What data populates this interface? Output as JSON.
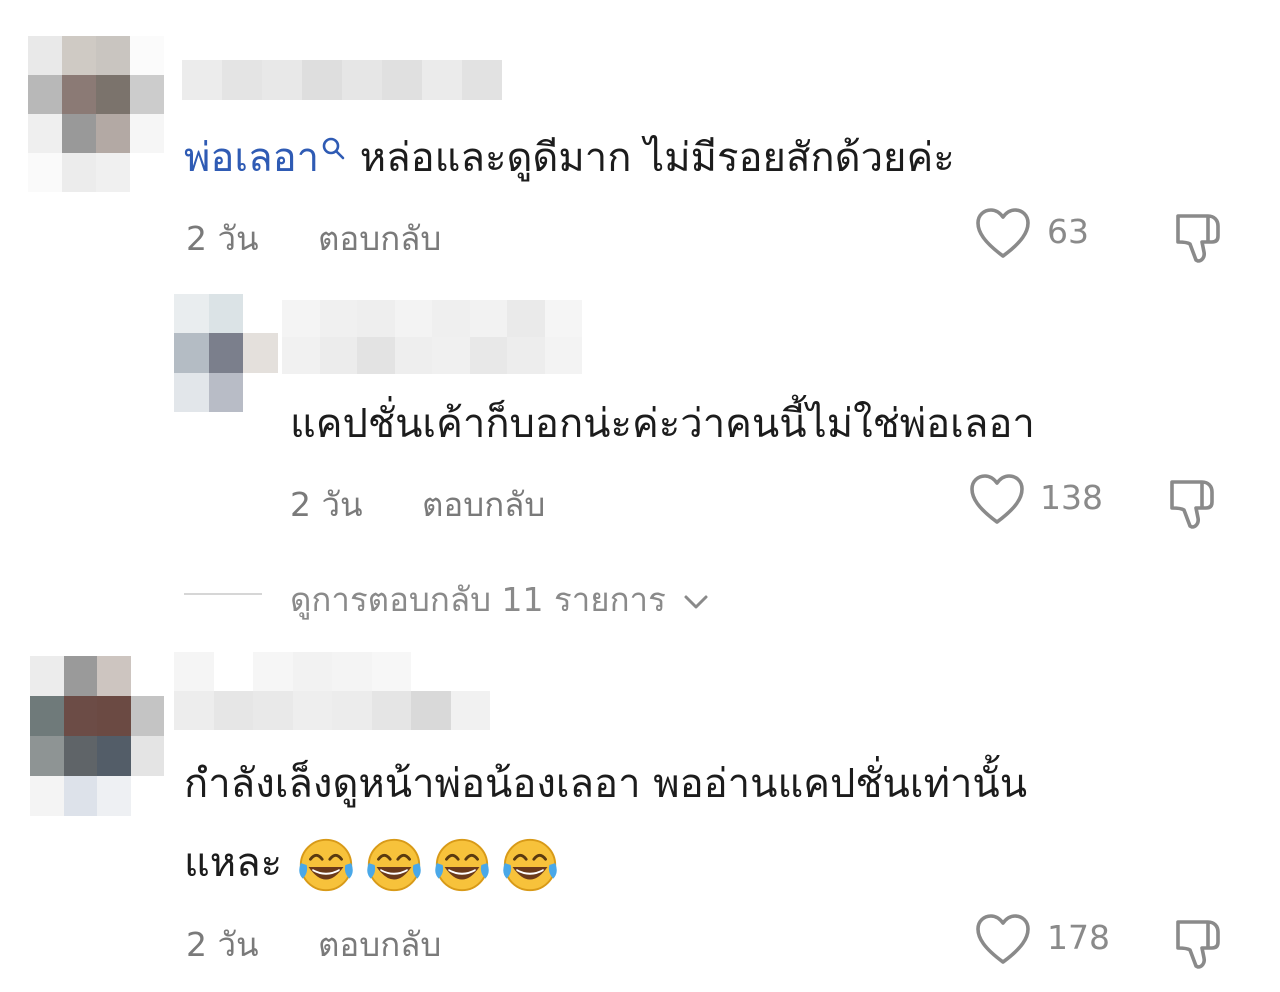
{
  "comments": [
    {
      "mention": "พ่อเลอา",
      "text": " หล่อและดูดีมาก ไม่มีรอยสักด้วยค่ะ",
      "time": "2 วัน",
      "reply_label": "ตอบกลับ",
      "likes": "63",
      "icons": {
        "like": "heart-outline-icon",
        "dislike": "thumbs-down-icon",
        "search": "search-icon"
      }
    },
    {
      "text": "แคปชั่นเค้าก็บอกน่ะค่ะว่าคนนี้ไม่ใช่พ่อเลอา",
      "time": "2 วัน",
      "reply_label": "ตอบกลับ",
      "likes": "138"
    },
    {
      "text_line1": "กำลังเล็งดูหน้าพ่อน้องเลอา พออ่านแคปชั่นเท่านั้น",
      "text_line2": "แหละ",
      "emoji": "face-with-tears-of-joy",
      "emoji_count": 4,
      "time": "2 วัน",
      "reply_label": "ตอบกลับ",
      "likes": "178"
    }
  ],
  "view_replies": {
    "label": "ดูการตอบกลับ 11 รายการ",
    "icon": "chevron-down-icon"
  },
  "colors": {
    "mention": "#2f5bb4",
    "text": "#1c1c1c",
    "meta": "#7a7a7a",
    "background": "#ffffff"
  }
}
